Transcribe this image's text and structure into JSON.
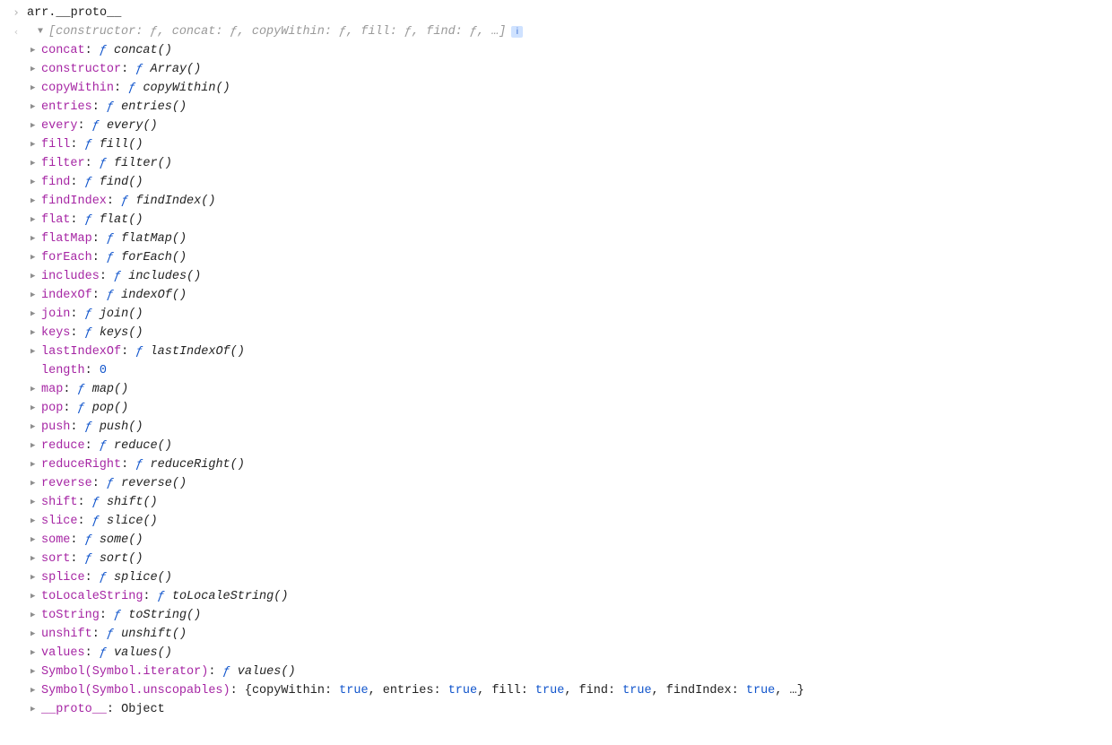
{
  "symbols": {
    "f": "ƒ",
    "info": "i"
  },
  "input_line": "arr.__proto__",
  "header_line": "[constructor: ƒ, concat: ƒ, copyWithin: ƒ, fill: ƒ, find: ƒ, …]",
  "length_prop": {
    "key": "length",
    "value": "0"
  },
  "fn_props": [
    {
      "key": "concat",
      "fn": "concat()"
    },
    {
      "key": "constructor",
      "fn": "Array()"
    },
    {
      "key": "copyWithin",
      "fn": "copyWithin()"
    },
    {
      "key": "entries",
      "fn": "entries()"
    },
    {
      "key": "every",
      "fn": "every()"
    },
    {
      "key": "fill",
      "fn": "fill()"
    },
    {
      "key": "filter",
      "fn": "filter()"
    },
    {
      "key": "find",
      "fn": "find()"
    },
    {
      "key": "findIndex",
      "fn": "findIndex()"
    },
    {
      "key": "flat",
      "fn": "flat()"
    },
    {
      "key": "flatMap",
      "fn": "flatMap()"
    },
    {
      "key": "forEach",
      "fn": "forEach()"
    },
    {
      "key": "includes",
      "fn": "includes()"
    },
    {
      "key": "indexOf",
      "fn": "indexOf()"
    },
    {
      "key": "join",
      "fn": "join()"
    },
    {
      "key": "keys",
      "fn": "keys()"
    },
    {
      "key": "lastIndexOf",
      "fn": "lastIndexOf()"
    }
  ],
  "fn_props_after_length": [
    {
      "key": "map",
      "fn": "map()"
    },
    {
      "key": "pop",
      "fn": "pop()"
    },
    {
      "key": "push",
      "fn": "push()"
    },
    {
      "key": "reduce",
      "fn": "reduce()"
    },
    {
      "key": "reduceRight",
      "fn": "reduceRight()"
    },
    {
      "key": "reverse",
      "fn": "reverse()"
    },
    {
      "key": "shift",
      "fn": "shift()"
    },
    {
      "key": "slice",
      "fn": "slice()"
    },
    {
      "key": "some",
      "fn": "some()"
    },
    {
      "key": "sort",
      "fn": "sort()"
    },
    {
      "key": "splice",
      "fn": "splice()"
    },
    {
      "key": "toLocaleString",
      "fn": "toLocaleString()"
    },
    {
      "key": "toString",
      "fn": "toString()"
    },
    {
      "key": "unshift",
      "fn": "unshift()"
    },
    {
      "key": "values",
      "fn": "values()"
    },
    {
      "key": "Symbol(Symbol.iterator)",
      "fn": "values()"
    }
  ],
  "unscopables": {
    "key": "Symbol(Symbol.unscopables)",
    "entries": [
      {
        "k": "copyWithin",
        "v": "true"
      },
      {
        "k": "entries",
        "v": "true"
      },
      {
        "k": "fill",
        "v": "true"
      },
      {
        "k": "find",
        "v": "true"
      },
      {
        "k": "findIndex",
        "v": "true"
      }
    ],
    "suffix": ", …}"
  },
  "proto_line": {
    "key": "__proto__",
    "value": "Object"
  }
}
